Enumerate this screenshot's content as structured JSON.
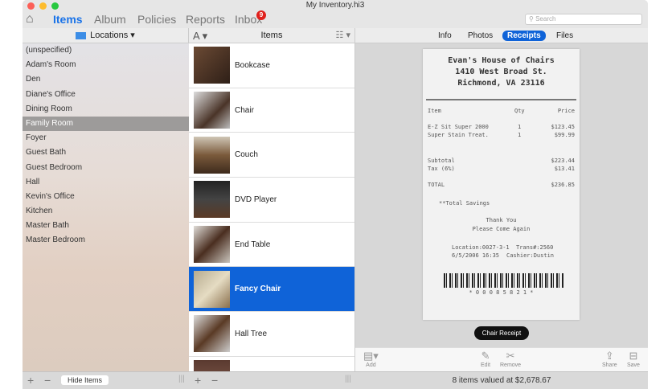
{
  "window": {
    "title": "My Inventory.hi3"
  },
  "toolbar": {
    "tabs": [
      "Items",
      "Album",
      "Policies",
      "Reports",
      "Inbox"
    ],
    "inbox_badge": "9",
    "search_placeholder": "Search"
  },
  "sidebar": {
    "header": "Locations ▾",
    "items": [
      "(unspecified)",
      "Adam's Room",
      "Den",
      "Diane's Office",
      "Dining Room",
      "Family Room",
      "Foyer",
      "Guest Bath",
      "Guest Bedroom",
      "Hall",
      "Kevin's Office",
      "Kitchen",
      "Master Bath",
      "Master Bedroom"
    ],
    "selected": "Family Room",
    "hide_button": "Hide Items"
  },
  "list": {
    "header": "Items",
    "sort_label": "A ▾",
    "view_label": "☷ ▾",
    "items": [
      "Bookcase",
      "Chair",
      "Couch",
      "DVD Player",
      "End Table",
      "Fancy Chair",
      "Hall Tree"
    ],
    "selected": "Fancy Chair"
  },
  "detail": {
    "tabs": [
      "Info",
      "Photos",
      "Receipts",
      "Files"
    ],
    "active_tab": "Receipts",
    "receipt": {
      "store": "Evan's House of Chairs",
      "address": "1410 West Broad St.",
      "city": "Richmond, VA 23116",
      "headers": [
        "Item",
        "Qty",
        "Price"
      ],
      "lines": [
        {
          "item": "E-Z Sit Super 2000",
          "qty": "1",
          "price": "$123.45"
        },
        {
          "item": "Super Stain Treat.",
          "qty": "1",
          "price": "$99.99"
        }
      ],
      "subtotal_label": "Subtotal",
      "subtotal": "$223.44",
      "tax_label": "Tax (6%)",
      "tax": "$13.41",
      "total_label": "TOTAL",
      "total": "$236.85",
      "savings": "**Total Savings",
      "thanks": "Thank You",
      "again": "Please Come Again",
      "location": "Location:0027-3-1",
      "trans": "Trans#:2560",
      "date": "6/5/2006 16:35",
      "cashier": "Cashier:Dustin",
      "barcode": "* 0 0 0 8 5 8 2 1 *"
    },
    "caption": "Chair Receipt",
    "tools": {
      "add": "Add",
      "edit": "Edit",
      "remove": "Remove",
      "share": "Share",
      "save": "Save"
    }
  },
  "status": "8 items valued at $2,678.67",
  "colors": {
    "accent": "#0f63d8",
    "badge": "#e0211d"
  }
}
